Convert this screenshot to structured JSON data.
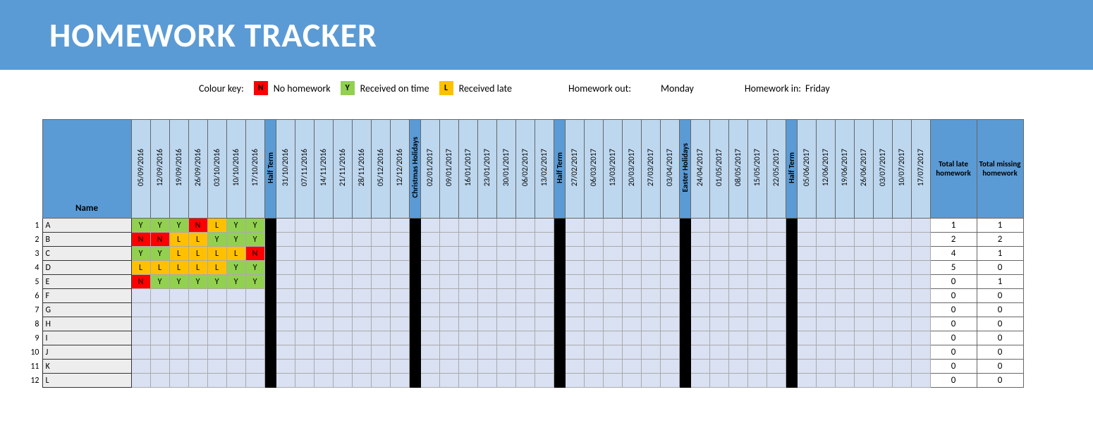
{
  "banner": "HOMEWORK TRACKER",
  "key": {
    "label": "Colour key:",
    "n_code": "N",
    "n_label": "No homework",
    "y_code": "Y",
    "y_label": "Received on time",
    "l_code": "L",
    "l_label": "Received late",
    "out_label": "Homework out:",
    "out_value": "Monday",
    "in_label": "Homework in:",
    "in_value": "Friday"
  },
  "headers": {
    "name": "Name",
    "total_late": "Total late homework",
    "total_missing": "Total missing homework"
  },
  "columns": [
    {
      "type": "date",
      "label": "05/09/2016"
    },
    {
      "type": "date",
      "label": "12/09/2016"
    },
    {
      "type": "date",
      "label": "19/09/2016"
    },
    {
      "type": "date",
      "label": "26/09/2016"
    },
    {
      "type": "date",
      "label": "03/10/2016"
    },
    {
      "type": "date",
      "label": "10/10/2016"
    },
    {
      "type": "date",
      "label": "17/10/2016"
    },
    {
      "type": "break",
      "label": "Half Term"
    },
    {
      "type": "date",
      "label": "31/10/2016"
    },
    {
      "type": "date",
      "label": "07/11/2016"
    },
    {
      "type": "date",
      "label": "14/11/2016"
    },
    {
      "type": "date",
      "label": "21/11/2016"
    },
    {
      "type": "date",
      "label": "28/11/2016"
    },
    {
      "type": "date",
      "label": "05/12/2016"
    },
    {
      "type": "date",
      "label": "12/12/2016"
    },
    {
      "type": "break",
      "label": "Christmas Holidays"
    },
    {
      "type": "date",
      "label": "02/01/2017"
    },
    {
      "type": "date",
      "label": "09/01/2017"
    },
    {
      "type": "date",
      "label": "16/01/2017"
    },
    {
      "type": "date",
      "label": "23/01/2017"
    },
    {
      "type": "date",
      "label": "30/01/2017"
    },
    {
      "type": "date",
      "label": "06/02/2017"
    },
    {
      "type": "date",
      "label": "13/02/2017"
    },
    {
      "type": "break",
      "label": "Half Term"
    },
    {
      "type": "date",
      "label": "27/02/2017"
    },
    {
      "type": "date",
      "label": "06/03/2017"
    },
    {
      "type": "date",
      "label": "13/03/2017"
    },
    {
      "type": "date",
      "label": "20/03/2017"
    },
    {
      "type": "date",
      "label": "27/03/2017"
    },
    {
      "type": "date",
      "label": "03/04/2017"
    },
    {
      "type": "break",
      "label": "Easter Holidays"
    },
    {
      "type": "date",
      "label": "24/04/2017"
    },
    {
      "type": "date",
      "label": "01/05/2017"
    },
    {
      "type": "date",
      "label": "08/05/2017"
    },
    {
      "type": "date",
      "label": "15/05/2017"
    },
    {
      "type": "date",
      "label": "22/05/2017"
    },
    {
      "type": "break",
      "label": "Half Term"
    },
    {
      "type": "date",
      "label": "05/06/2017"
    },
    {
      "type": "date",
      "label": "12/06/2017"
    },
    {
      "type": "date",
      "label": "19/06/2017"
    },
    {
      "type": "date",
      "label": "26/06/2017"
    },
    {
      "type": "date",
      "label": "03/07/2017"
    },
    {
      "type": "date",
      "label": "10/07/2017"
    },
    {
      "type": "date",
      "label": "17/07/2017"
    }
  ],
  "rows": [
    {
      "num": "1",
      "name": "A",
      "marks": [
        "Y",
        "Y",
        "Y",
        "N",
        "L",
        "Y",
        "Y"
      ],
      "late": "1",
      "missing": "1"
    },
    {
      "num": "2",
      "name": "B",
      "marks": [
        "N",
        "N",
        "L",
        "L",
        "Y",
        "Y",
        "Y"
      ],
      "late": "2",
      "missing": "2"
    },
    {
      "num": "3",
      "name": "C",
      "marks": [
        "Y",
        "Y",
        "L",
        "L",
        "L",
        "L",
        "N"
      ],
      "late": "4",
      "missing": "1"
    },
    {
      "num": "4",
      "name": "D",
      "marks": [
        "L",
        "L",
        "L",
        "L",
        "L",
        "Y",
        "Y"
      ],
      "late": "5",
      "missing": "0"
    },
    {
      "num": "5",
      "name": "E",
      "marks": [
        "N",
        "Y",
        "Y",
        "Y",
        "Y",
        "Y",
        "Y"
      ],
      "late": "0",
      "missing": "1"
    },
    {
      "num": "6",
      "name": "F",
      "marks": [],
      "late": "0",
      "missing": "0"
    },
    {
      "num": "7",
      "name": "G",
      "marks": [],
      "late": "0",
      "missing": "0"
    },
    {
      "num": "8",
      "name": "H",
      "marks": [],
      "late": "0",
      "missing": "0"
    },
    {
      "num": "9",
      "name": "I",
      "marks": [],
      "late": "0",
      "missing": "0"
    },
    {
      "num": "10",
      "name": "J",
      "marks": [],
      "late": "0",
      "missing": "0"
    },
    {
      "num": "11",
      "name": "K",
      "marks": [],
      "late": "0",
      "missing": "0"
    },
    {
      "num": "12",
      "name": "L",
      "marks": [],
      "late": "0",
      "missing": "0"
    }
  ]
}
